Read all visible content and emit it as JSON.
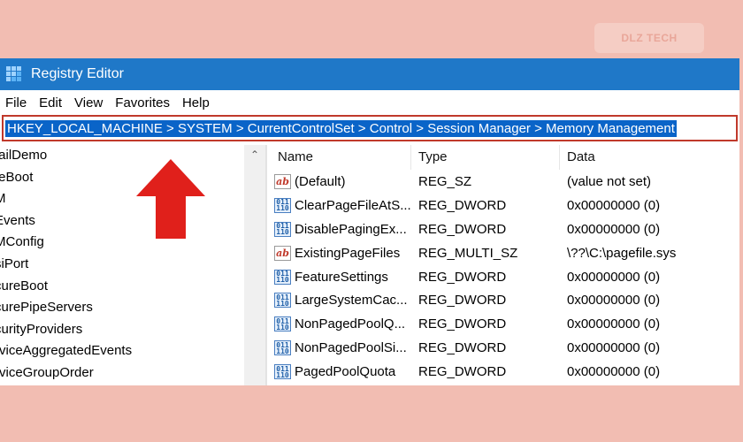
{
  "colors": {
    "background": "#f2bdb2",
    "titlebar": "#1f78c8",
    "address_highlight": "#0a64c8",
    "frame_red": "#c0392b",
    "arrow_red": "#e0201b"
  },
  "watermark": {
    "brand": "DLZ TECH"
  },
  "window": {
    "title": "Registry Editor",
    "icon": "registry-icon"
  },
  "menu": [
    "File",
    "Edit",
    "View",
    "Favorites",
    "Help"
  ],
  "address": {
    "path": "HKEY_LOCAL_MACHINE > SYSTEM > CurrentControlSet > Control > Session Manager > Memory Management"
  },
  "tree": {
    "items": [
      "tailDemo",
      "feBoot",
      "M",
      "Events",
      "MConfig",
      "siPort",
      "cureBoot",
      "curePipeServers",
      "curityProviders",
      "rviceAggregatedEvents",
      "rviceGroupOrder"
    ]
  },
  "values": {
    "headers": {
      "name": "Name",
      "type": "Type",
      "data": "Data"
    },
    "rows": [
      {
        "icon": "string-value-icon",
        "name": "(Default)",
        "type": "REG_SZ",
        "data": "(value not set)"
      },
      {
        "icon": "binary-value-icon",
        "name": "ClearPageFileAtS...",
        "type": "REG_DWORD",
        "data": "0x00000000 (0)"
      },
      {
        "icon": "binary-value-icon",
        "name": "DisablePagingEx...",
        "type": "REG_DWORD",
        "data": "0x00000000 (0)"
      },
      {
        "icon": "string-value-icon",
        "name": "ExistingPageFiles",
        "type": "REG_MULTI_SZ",
        "data": "\\??\\C:\\pagefile.sys"
      },
      {
        "icon": "binary-value-icon",
        "name": "FeatureSettings",
        "type": "REG_DWORD",
        "data": "0x00000000 (0)"
      },
      {
        "icon": "binary-value-icon",
        "name": "LargeSystemCac...",
        "type": "REG_DWORD",
        "data": "0x00000000 (0)"
      },
      {
        "icon": "binary-value-icon",
        "name": "NonPagedPoolQ...",
        "type": "REG_DWORD",
        "data": "0x00000000 (0)"
      },
      {
        "icon": "binary-value-icon",
        "name": "NonPagedPoolSi...",
        "type": "REG_DWORD",
        "data": "0x00000000 (0)"
      },
      {
        "icon": "binary-value-icon",
        "name": "PagedPoolQuota",
        "type": "REG_DWORD",
        "data": "0x00000000 (0)"
      }
    ]
  }
}
